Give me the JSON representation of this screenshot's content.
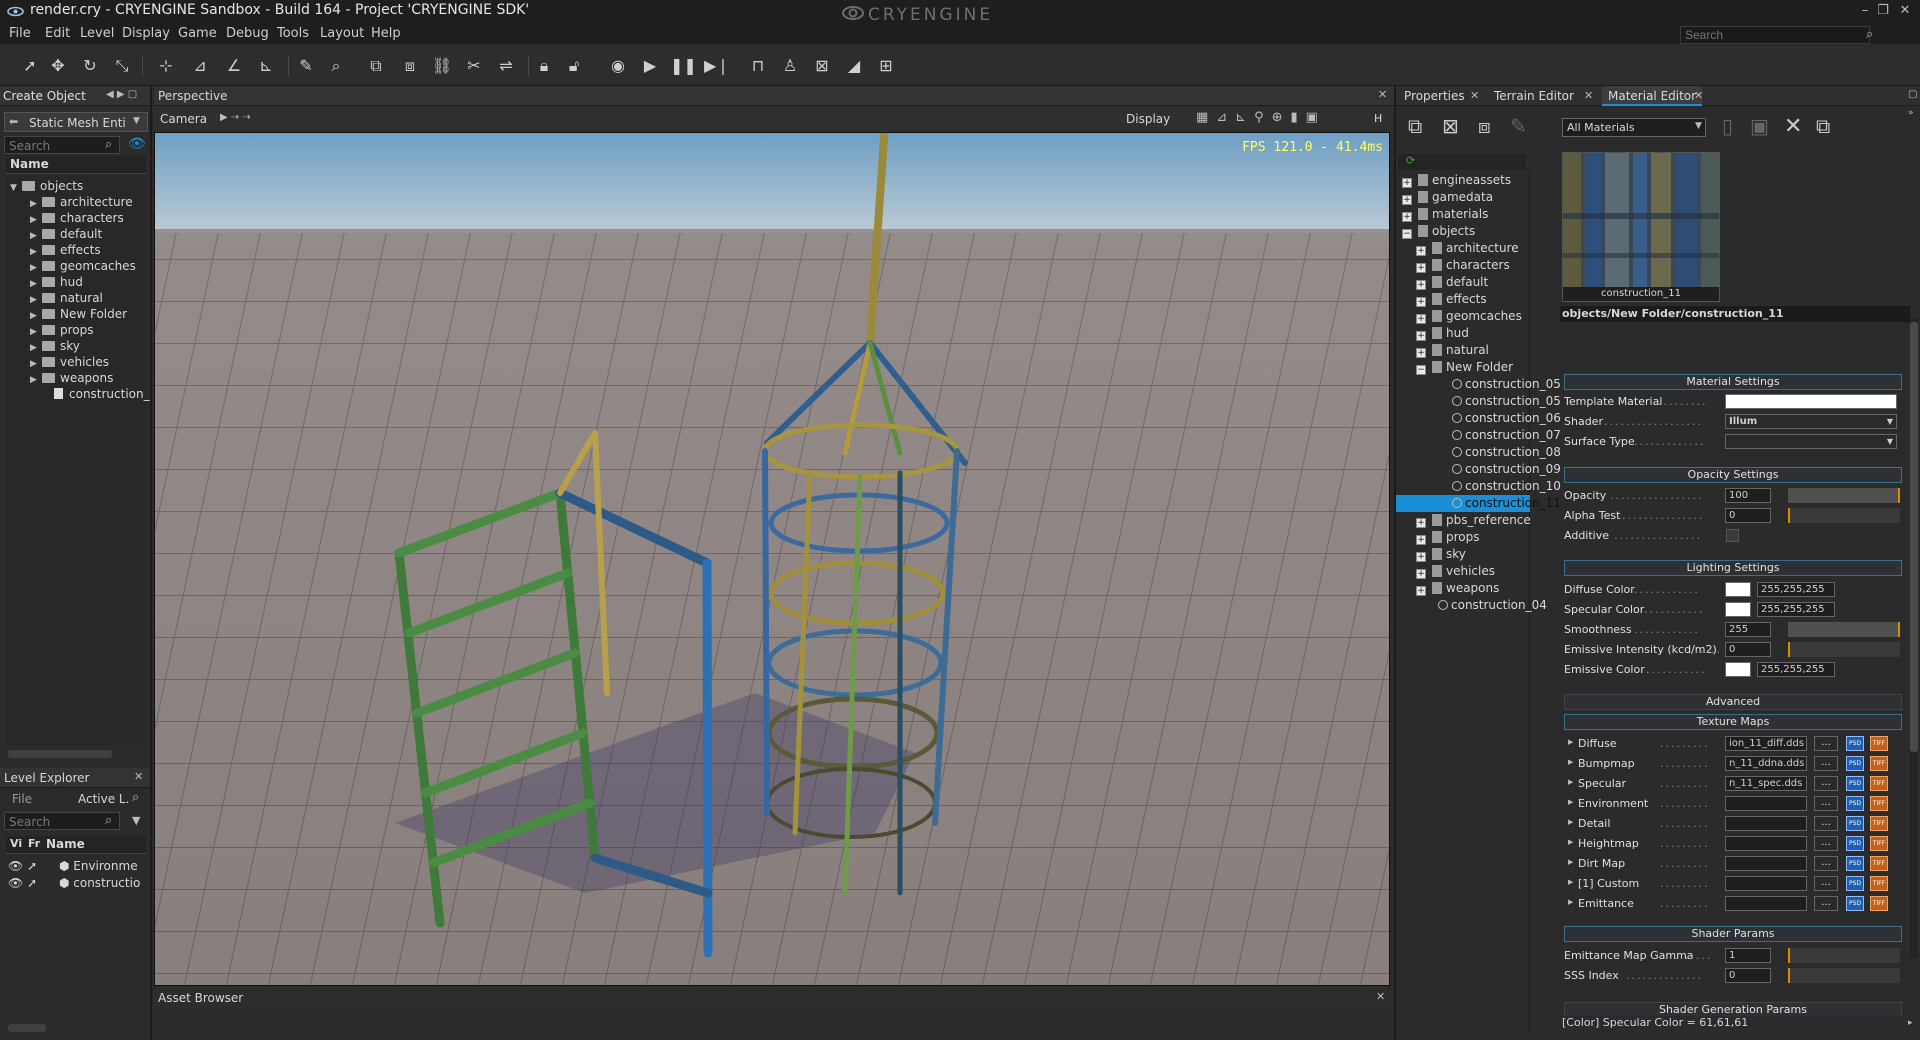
{
  "window": {
    "title": "render.cry - CRYENGINE Sandbox - Build 164 - Project 'CRYENGINE SDK'",
    "brand": "CRYENGINE",
    "controls": [
      "–",
      "❐",
      "✕"
    ]
  },
  "menu": [
    "File",
    "Edit",
    "Level",
    "Display",
    "Game",
    "Debug",
    "Tools",
    "Layout",
    "Help"
  ],
  "search": {
    "placeholder": "Search"
  },
  "create_object": {
    "title": "Create Object",
    "dropdown": "Static Mesh Entity",
    "search_placeholder": "Search",
    "column": "Name",
    "root": "objects",
    "folders": [
      "architecture",
      "characters",
      "default",
      "effects",
      "geomcaches",
      "hud",
      "natural",
      "New Folder",
      "props",
      "sky",
      "vehicles",
      "weapons"
    ],
    "file": "construction_"
  },
  "level_explorer": {
    "title": "Level Explorer",
    "file_label": "File",
    "active_layer": "Active L.",
    "search_placeholder": "Search",
    "columns": [
      "Vi",
      "Fr",
      "Name"
    ],
    "rows": [
      "Environme",
      "constructio"
    ]
  },
  "viewport": {
    "title": "Perspective",
    "camera": "Camera",
    "display": "Display",
    "fps": "FPS 121.0 - 41.4ms",
    "h_label": "H"
  },
  "asset_browser": {
    "title": "Asset Browser"
  },
  "right_tabs": [
    "Properties",
    "Terrain Editor",
    "Material Editor"
  ],
  "material_editor": {
    "filter": "All Materials",
    "tree": {
      "top": [
        "engineassets",
        "gamedata",
        "materials",
        "objects"
      ],
      "objects": [
        "architecture",
        "characters",
        "default",
        "effects",
        "geomcaches",
        "hud",
        "natural",
        "New Folder"
      ],
      "new_folder_items": [
        "construction_05",
        "construction_05",
        "construction_06",
        "construction_07",
        "construction_08",
        "construction_09",
        "construction_10",
        "construction_11"
      ],
      "after": [
        "pbs_reference",
        "props",
        "sky",
        "vehicles",
        "weapons"
      ],
      "last": "construction_04"
    },
    "preview_caption": "construction_11",
    "path": "objects/New Folder/construction_11",
    "sections": {
      "material": "Material Settings",
      "opacity": "Opacity Settings",
      "lighting": "Lighting Settings",
      "advanced": "Advanced",
      "texture": "Texture Maps",
      "shader_params": "Shader Params",
      "shader_gen": "Shader Generation Params"
    },
    "material_settings": {
      "template": "Template Material",
      "shader_label": "Shader",
      "shader_value": "Illum",
      "surface": "Surface Type"
    },
    "opacity": {
      "opacity_label": "Opacity",
      "opacity_value": "100",
      "alpha_label": "Alpha Test",
      "alpha_value": "0",
      "additive_label": "Additive"
    },
    "lighting": {
      "diffuse_label": "Diffuse Color",
      "diffuse_value": "255,255,255",
      "specular_label": "Specular Color",
      "specular_value": "255,255,255",
      "smooth_label": "Smoothness",
      "smooth_value": "255",
      "emissive_int_label": "Emissive Intensity (kcd/m2)",
      "emissive_int_value": "0",
      "emissive_color_label": "Emissive Color",
      "emissive_color_value": "255,255,255"
    },
    "textures": [
      {
        "label": "Diffuse",
        "value": "ion_11_diff.dds"
      },
      {
        "label": "Bumpmap",
        "value": "n_11_ddna.dds"
      },
      {
        "label": "Specular",
        "value": "n_11_spec.dds"
      },
      {
        "label": "Environment",
        "value": ""
      },
      {
        "label": "Detail",
        "value": ""
      },
      {
        "label": "Heightmap",
        "value": ""
      },
      {
        "label": "Dirt Map",
        "value": ""
      },
      {
        "label": "[1] Custom",
        "value": ""
      },
      {
        "label": "Emittance",
        "value": ""
      }
    ],
    "texture_button": "...",
    "psd": "PSD",
    "tif": "TIFF",
    "shader_params": {
      "gamma_label": "Emittance Map Gamma",
      "gamma_value": "1",
      "sss_label": "SSS Index",
      "sss_value": "0"
    },
    "status": "[Color] Specular Color = 61,61,61"
  },
  "colors": {
    "accent": "#1a8fd6",
    "slider_marker": "#d88a00",
    "sky": "#7fa6c4",
    "floor": "#8a8280"
  }
}
